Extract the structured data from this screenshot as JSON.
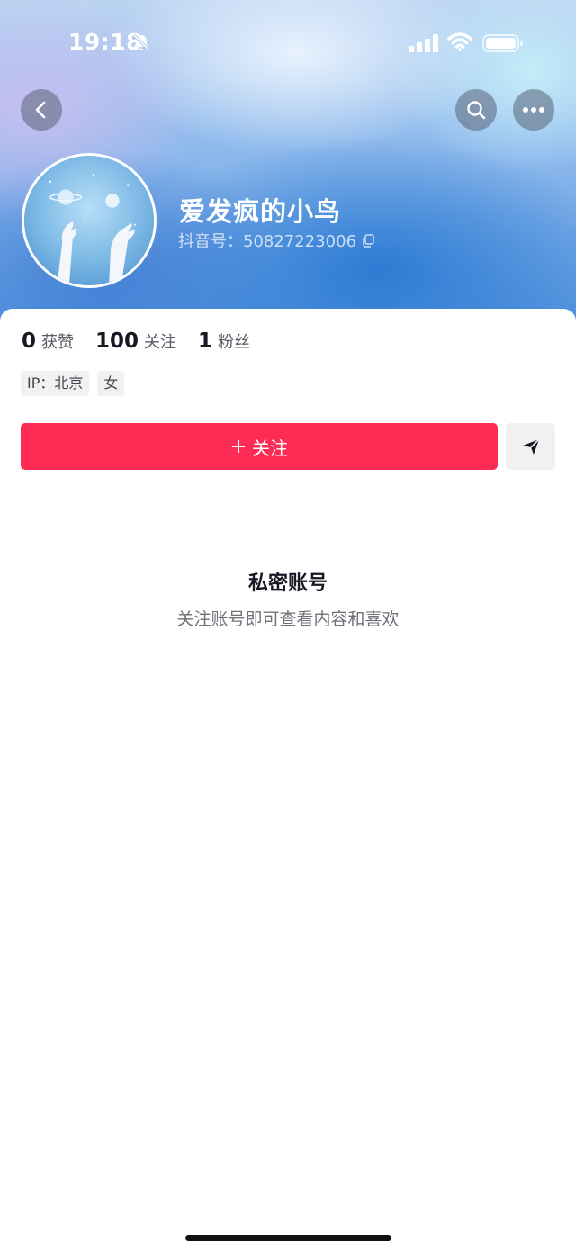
{
  "status_bar": {
    "time": "19:18"
  },
  "profile": {
    "username": "爱发疯的小鸟",
    "douyin_id": "抖音号：50827223006"
  },
  "stats": [
    {
      "value": "0",
      "label": "获赞"
    },
    {
      "value": "100",
      "label": "关注"
    },
    {
      "value": "1",
      "label": "粉丝"
    }
  ],
  "tags": [
    "IP：北京",
    "女"
  ],
  "actions": {
    "follow_label": "关注"
  },
  "private_notice": {
    "title": "私密账号",
    "subtitle": "关注账号即可查看内容和喜欢"
  },
  "colors": {
    "follow_button": "#fe2c55",
    "text_primary": "#161823",
    "text_secondary": "#6f7179"
  },
  "icons": [
    "bell-mute-icon",
    "signal-icon",
    "wifi-icon",
    "battery-icon",
    "back-arrow-icon",
    "search-icon",
    "more-icon",
    "copy-icon",
    "plus-icon",
    "send-icon"
  ]
}
